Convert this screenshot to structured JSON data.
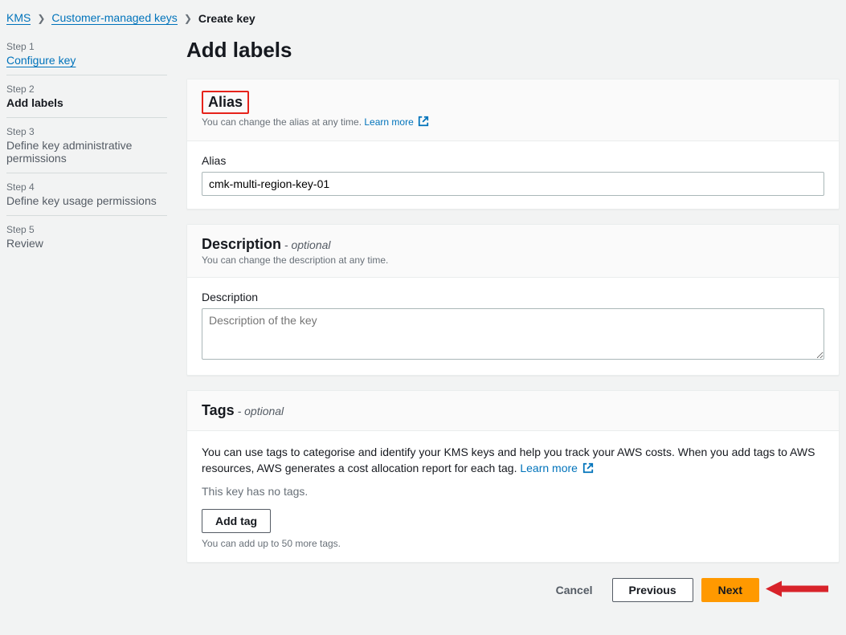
{
  "breadcrumb": {
    "items": [
      {
        "label": "KMS",
        "link": true
      },
      {
        "label": "Customer-managed keys",
        "link": true
      },
      {
        "label": "Create key",
        "link": false
      }
    ]
  },
  "sidebar": {
    "steps": [
      {
        "num": "Step 1",
        "label": "Configure key",
        "link": true,
        "active": false
      },
      {
        "num": "Step 2",
        "label": "Add labels",
        "link": false,
        "active": true
      },
      {
        "num": "Step 3",
        "label": "Define key administrative permissions",
        "link": false,
        "active": false
      },
      {
        "num": "Step 4",
        "label": "Define key usage permissions",
        "link": false,
        "active": false
      },
      {
        "num": "Step 5",
        "label": "Review",
        "link": false,
        "active": false
      }
    ]
  },
  "main": {
    "title": "Add labels",
    "alias": {
      "section_title": "Alias",
      "section_desc": "You can change the alias at any time.",
      "learn_more": "Learn more",
      "field_label": "Alias",
      "value": "cmk-multi-region-key-01"
    },
    "description": {
      "section_title": "Description",
      "optional": " - optional",
      "section_desc": "You can change the description at any time.",
      "field_label": "Description",
      "placeholder": "Description of the key",
      "value": ""
    },
    "tags": {
      "section_title": "Tags",
      "optional": " - optional",
      "body_text": "You can use tags to categorise and identify your KMS keys and help you track your AWS costs. When you add tags to AWS resources, AWS generates a cost allocation report for each tag.",
      "learn_more": "Learn more",
      "empty_text": "This key has no tags.",
      "add_tag_label": "Add tag",
      "hint": "You can add up to 50 more tags."
    },
    "actions": {
      "cancel": "Cancel",
      "previous": "Previous",
      "next": "Next"
    }
  }
}
